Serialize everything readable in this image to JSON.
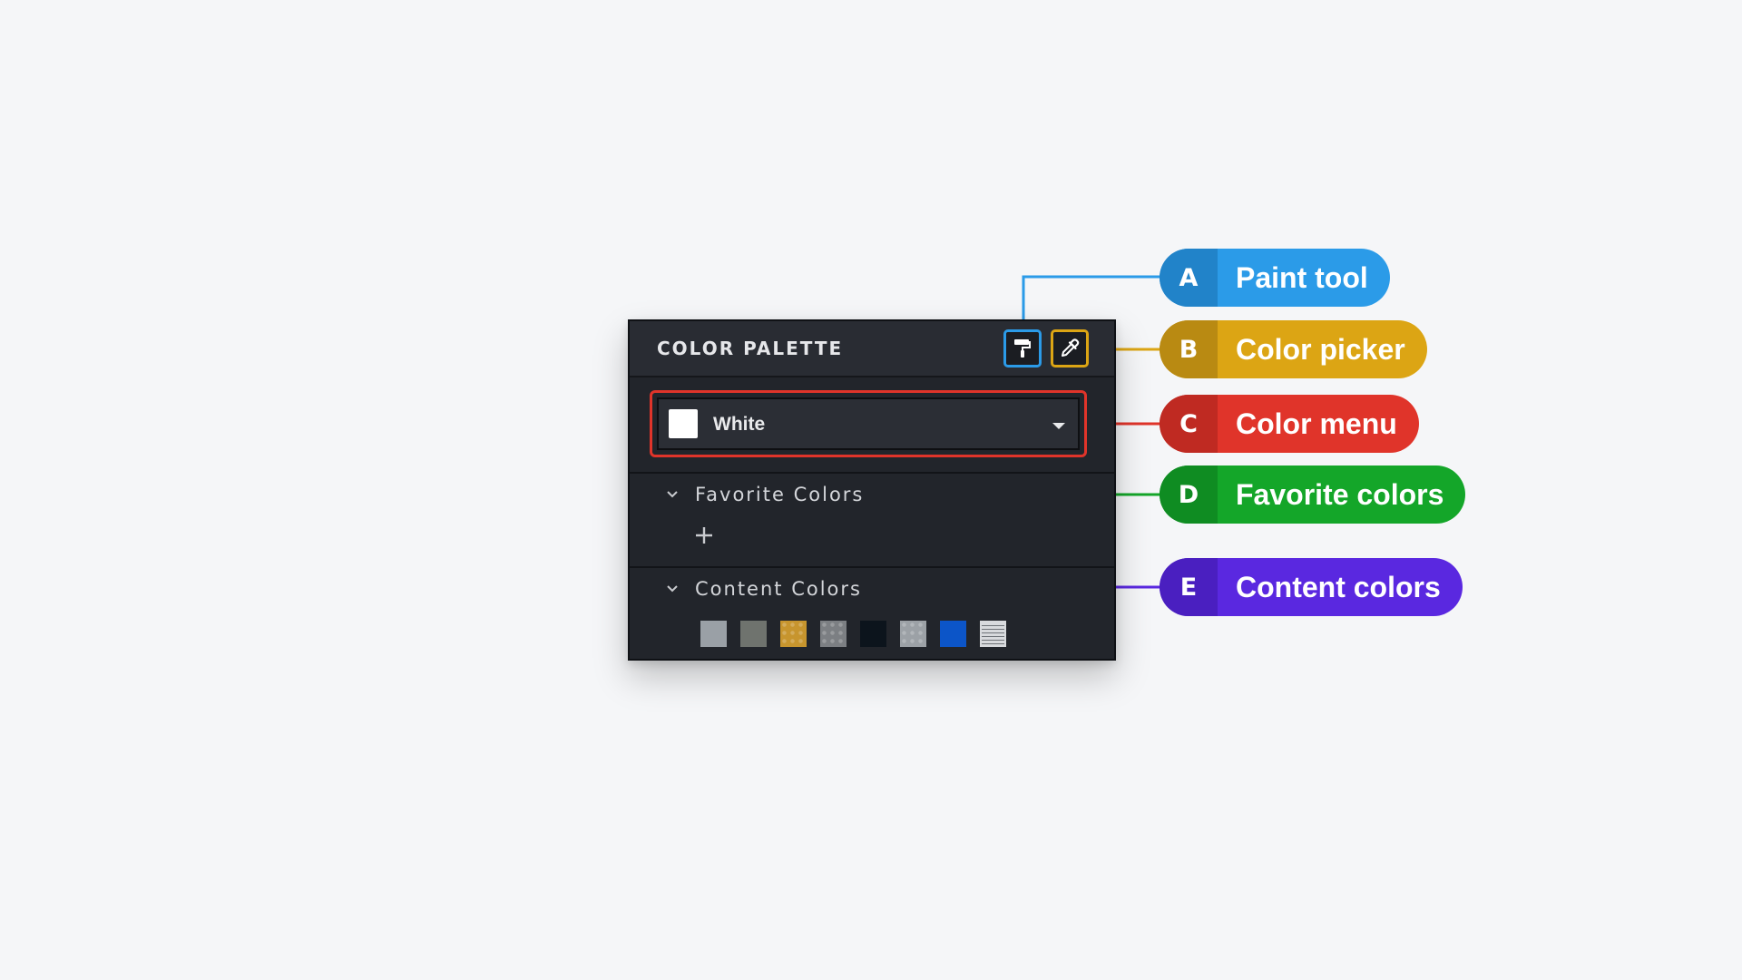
{
  "panel": {
    "title": "COLOR PALETTE",
    "tools": {
      "paint": {
        "icon": "paint-roller-icon"
      },
      "picker": {
        "icon": "eyedropper-icon"
      }
    },
    "color_menu": {
      "selected": "White",
      "selected_color": "#ffffff"
    },
    "favorite_section": {
      "label": "Favorite Colors",
      "add_icon": "plus-icon"
    },
    "content_section": {
      "label": "Content Colors",
      "swatches": [
        {
          "color": "#9aa0a6",
          "pattern": "solid"
        },
        {
          "color": "#6f736e",
          "pattern": "solid"
        },
        {
          "color": "#c7952e",
          "pattern": "dotted"
        },
        {
          "color": "#7c7f83",
          "pattern": "dotted"
        },
        {
          "color": "#0c141c",
          "pattern": "solid"
        },
        {
          "color": "#9ca1a6",
          "pattern": "dotted"
        },
        {
          "color": "#0c55c8",
          "pattern": "solid"
        },
        {
          "color": "#d8dadd",
          "pattern": "lined"
        }
      ]
    }
  },
  "callouts": [
    {
      "letter": "A",
      "label": "Paint tool",
      "color": "#2b9be8",
      "dark": "#2183c9"
    },
    {
      "letter": "B",
      "label": "Color picker",
      "color": "#dca514",
      "dark": "#b98a12"
    },
    {
      "letter": "C",
      "label": "Color menu",
      "color": "#e0342a",
      "dark": "#bf2a22"
    },
    {
      "letter": "D",
      "label": "Favorite colors",
      "color": "#14a629",
      "dark": "#0f8c22"
    },
    {
      "letter": "E",
      "label": "Content colors",
      "color": "#5a28e0",
      "dark": "#4a1fc0"
    }
  ]
}
